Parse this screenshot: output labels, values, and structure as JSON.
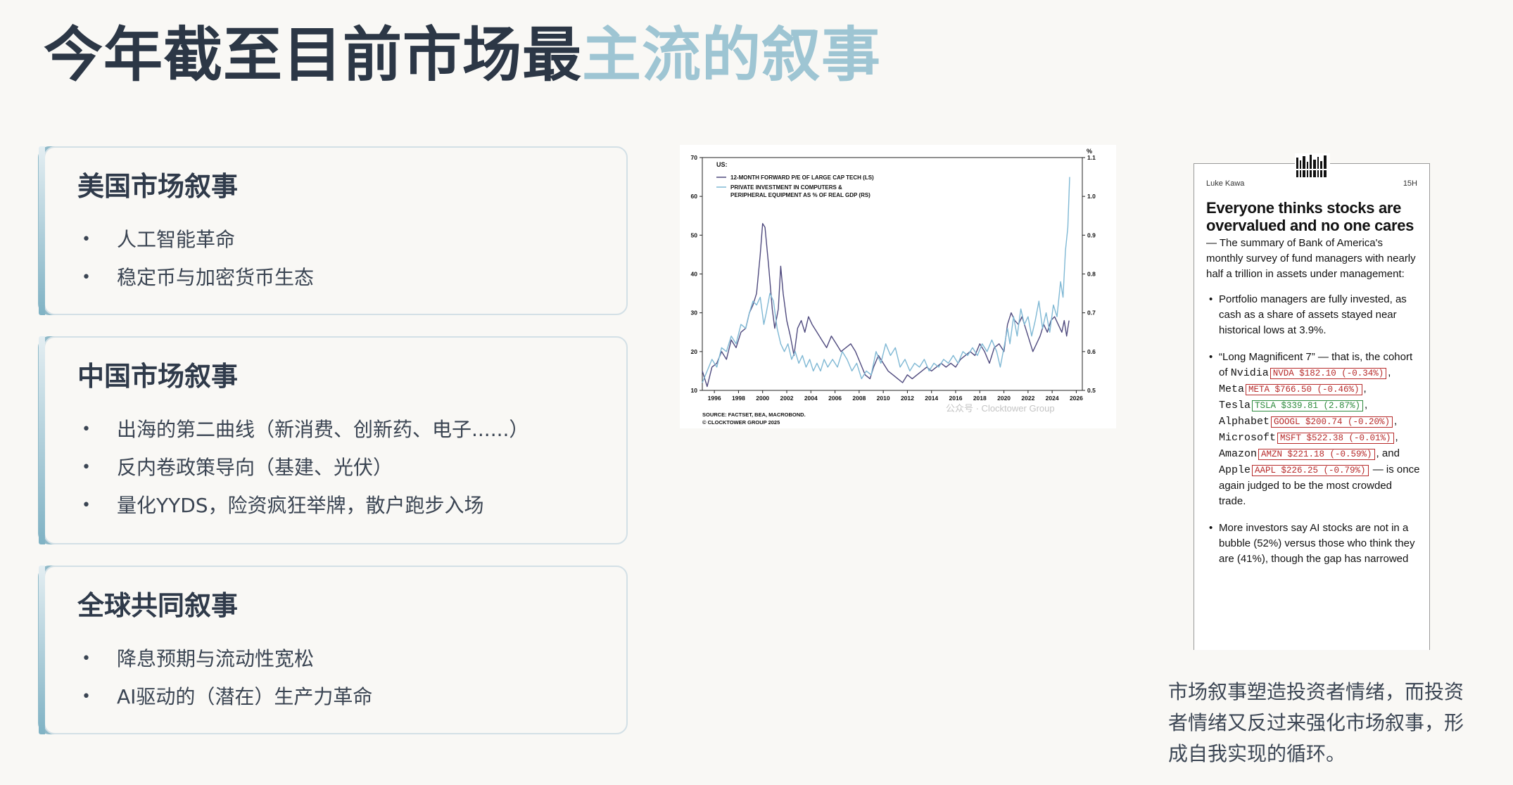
{
  "title": {
    "dark": "今年截至目前市场最",
    "light": "主流的叙事"
  },
  "cards": [
    {
      "title": "美国市场叙事",
      "items": [
        "人工智能革命",
        "稳定币与加密货币生态"
      ]
    },
    {
      "title": "中国市场叙事",
      "items": [
        "出海的第二曲线（新消费、创新药、电子......）",
        "反内卷政策导向（基建、光伏）",
        "量化YYDS，险资疯狂举牌，散户跑步入场"
      ]
    },
    {
      "title": "全球共同叙事",
      "items": [
        "降息预期与流动性宽松",
        "AI驱动的（潜在）生产力革命"
      ]
    }
  ],
  "chart_data": {
    "type": "line",
    "title": "US:",
    "unit_right": "%",
    "xlim": [
      1995,
      2026.5
    ],
    "x_ticks": [
      "1996",
      "1998",
      "2000",
      "2002",
      "2004",
      "2006",
      "2008",
      "2010",
      "2012",
      "2014",
      "2016",
      "2018",
      "2020",
      "2022",
      "2024",
      "2026"
    ],
    "ylim_left": [
      10,
      70
    ],
    "y_ticks_left": [
      "10",
      "20",
      "30",
      "40",
      "50",
      "60",
      "70"
    ],
    "ylim_right": [
      0.5,
      1.1
    ],
    "y_ticks_right": [
      "0.5",
      "0.6",
      "0.7",
      "0.8",
      "0.9",
      "1.0",
      "1.1"
    ],
    "series": [
      {
        "name": "12-MONTH FORWARD P/E OF LARGE CAP TECH (LS)",
        "axis": "left",
        "color": "#4f4a7e",
        "points": [
          [
            1995.0,
            15
          ],
          [
            1995.4,
            11
          ],
          [
            1995.8,
            16
          ],
          [
            1996.2,
            17
          ],
          [
            1996.6,
            20
          ],
          [
            1997.0,
            18
          ],
          [
            1997.4,
            23
          ],
          [
            1997.8,
            21
          ],
          [
            1998.2,
            25
          ],
          [
            1998.6,
            26
          ],
          [
            1998.9,
            30
          ],
          [
            1999.2,
            32
          ],
          [
            1999.5,
            35
          ],
          [
            1999.8,
            45
          ],
          [
            2000.0,
            53
          ],
          [
            2000.2,
            52
          ],
          [
            2000.5,
            42
          ],
          [
            2000.8,
            31
          ],
          [
            2001.0,
            26
          ],
          [
            2001.3,
            31
          ],
          [
            2001.5,
            42
          ],
          [
            2001.7,
            35
          ],
          [
            2002.0,
            28
          ],
          [
            2002.3,
            24
          ],
          [
            2002.6,
            19
          ],
          [
            2002.9,
            26
          ],
          [
            2003.2,
            28
          ],
          [
            2003.5,
            25
          ],
          [
            2003.8,
            29
          ],
          [
            2004.1,
            27
          ],
          [
            2004.5,
            25
          ],
          [
            2004.9,
            23
          ],
          [
            2005.3,
            21
          ],
          [
            2005.7,
            24
          ],
          [
            2006.1,
            22
          ],
          [
            2006.5,
            20
          ],
          [
            2006.9,
            21
          ],
          [
            2007.3,
            22
          ],
          [
            2007.7,
            20
          ],
          [
            2008.1,
            17
          ],
          [
            2008.5,
            14
          ],
          [
            2008.9,
            13
          ],
          [
            2009.2,
            16
          ],
          [
            2009.6,
            19
          ],
          [
            2010.0,
            17
          ],
          [
            2010.4,
            15
          ],
          [
            2010.8,
            14
          ],
          [
            2011.2,
            13
          ],
          [
            2011.6,
            12
          ],
          [
            2012.0,
            14
          ],
          [
            2012.4,
            13
          ],
          [
            2012.8,
            14
          ],
          [
            2013.2,
            15
          ],
          [
            2013.6,
            16
          ],
          [
            2014.0,
            15
          ],
          [
            2014.4,
            16
          ],
          [
            2014.8,
            17
          ],
          [
            2015.2,
            16
          ],
          [
            2015.6,
            17
          ],
          [
            2016.0,
            16
          ],
          [
            2016.4,
            18
          ],
          [
            2016.8,
            19
          ],
          [
            2017.2,
            20
          ],
          [
            2017.6,
            19
          ],
          [
            2018.0,
            22
          ],
          [
            2018.4,
            20
          ],
          [
            2018.8,
            17
          ],
          [
            2019.2,
            21
          ],
          [
            2019.6,
            22
          ],
          [
            2020.0,
            20
          ],
          [
            2020.3,
            27
          ],
          [
            2020.6,
            30
          ],
          [
            2020.9,
            28
          ],
          [
            2021.2,
            27
          ],
          [
            2021.5,
            29
          ],
          [
            2021.8,
            26
          ],
          [
            2022.1,
            23
          ],
          [
            2022.4,
            20
          ],
          [
            2022.7,
            22
          ],
          [
            2023.0,
            24
          ],
          [
            2023.3,
            27
          ],
          [
            2023.6,
            25
          ],
          [
            2023.9,
            28
          ],
          [
            2024.2,
            29
          ],
          [
            2024.5,
            27
          ],
          [
            2024.8,
            25
          ],
          [
            2025.0,
            28
          ],
          [
            2025.2,
            24
          ],
          [
            2025.4,
            28
          ]
        ]
      },
      {
        "name": "PRIVATE INVESTMENT IN COMPUTERS & PERIPHERAL EQUIPMENT AS % OF REAL GDP (RS)",
        "axis": "right",
        "color": "#7fb8d4",
        "points": [
          [
            1995.0,
            0.52
          ],
          [
            1995.4,
            0.55
          ],
          [
            1995.8,
            0.58
          ],
          [
            1996.2,
            0.56
          ],
          [
            1996.6,
            0.61
          ],
          [
            1997.0,
            0.6
          ],
          [
            1997.4,
            0.64
          ],
          [
            1997.8,
            0.62
          ],
          [
            1998.2,
            0.67
          ],
          [
            1998.6,
            0.66
          ],
          [
            1998.9,
            0.7
          ],
          [
            1999.2,
            0.73
          ],
          [
            1999.5,
            0.72
          ],
          [
            1999.8,
            0.74
          ],
          [
            2000.1,
            0.67
          ],
          [
            2000.3,
            0.7
          ],
          [
            2000.6,
            0.75
          ],
          [
            2000.9,
            0.73
          ],
          [
            2001.2,
            0.66
          ],
          [
            2001.5,
            0.62
          ],
          [
            2001.8,
            0.6
          ],
          [
            2002.1,
            0.62
          ],
          [
            2002.4,
            0.58
          ],
          [
            2002.7,
            0.6
          ],
          [
            2003.0,
            0.57
          ],
          [
            2003.3,
            0.59
          ],
          [
            2003.6,
            0.56
          ],
          [
            2003.9,
            0.58
          ],
          [
            2004.2,
            0.55
          ],
          [
            2004.5,
            0.57
          ],
          [
            2004.8,
            0.55
          ],
          [
            2005.1,
            0.58
          ],
          [
            2005.4,
            0.56
          ],
          [
            2005.8,
            0.58
          ],
          [
            2006.2,
            0.56
          ],
          [
            2006.6,
            0.6
          ],
          [
            2007.0,
            0.58
          ],
          [
            2007.4,
            0.55
          ],
          [
            2007.8,
            0.57
          ],
          [
            2008.2,
            0.53
          ],
          [
            2008.6,
            0.55
          ],
          [
            2009.0,
            0.54
          ],
          [
            2009.4,
            0.6
          ],
          [
            2009.8,
            0.57
          ],
          [
            2010.2,
            0.62
          ],
          [
            2010.6,
            0.59
          ],
          [
            2011.0,
            0.61
          ],
          [
            2011.4,
            0.56
          ],
          [
            2011.8,
            0.58
          ],
          [
            2012.2,
            0.55
          ],
          [
            2012.6,
            0.57
          ],
          [
            2013.0,
            0.56
          ],
          [
            2013.4,
            0.58
          ],
          [
            2013.8,
            0.55
          ],
          [
            2014.2,
            0.57
          ],
          [
            2014.6,
            0.56
          ],
          [
            2015.0,
            0.58
          ],
          [
            2015.4,
            0.57
          ],
          [
            2015.8,
            0.59
          ],
          [
            2016.2,
            0.57
          ],
          [
            2016.6,
            0.6
          ],
          [
            2017.0,
            0.59
          ],
          [
            2017.4,
            0.61
          ],
          [
            2017.8,
            0.59
          ],
          [
            2018.2,
            0.62
          ],
          [
            2018.6,
            0.6
          ],
          [
            2019.0,
            0.63
          ],
          [
            2019.4,
            0.6
          ],
          [
            2019.7,
            0.56
          ],
          [
            2020.0,
            0.61
          ],
          [
            2020.3,
            0.66
          ],
          [
            2020.5,
            0.62
          ],
          [
            2020.8,
            0.69
          ],
          [
            2021.1,
            0.64
          ],
          [
            2021.4,
            0.71
          ],
          [
            2021.7,
            0.67
          ],
          [
            2022.0,
            0.69
          ],
          [
            2022.3,
            0.64
          ],
          [
            2022.6,
            0.68
          ],
          [
            2022.9,
            0.73
          ],
          [
            2023.2,
            0.66
          ],
          [
            2023.5,
            0.7
          ],
          [
            2023.8,
            0.65
          ],
          [
            2024.1,
            0.72
          ],
          [
            2024.4,
            0.69
          ],
          [
            2024.7,
            0.78
          ],
          [
            2024.9,
            0.74
          ],
          [
            2025.1,
            0.86
          ],
          [
            2025.3,
            0.92
          ],
          [
            2025.45,
            1.05
          ]
        ]
      }
    ],
    "source": "SOURCE: FACTSET, BEA, MACROBOND.",
    "copyright": "© CLOCKTOWER GROUP 2025",
    "watermark": "公众号 · Clocktower Group"
  },
  "tweet": {
    "author": "Luke Kawa",
    "time": "15H",
    "headline": "Everyone thinks stocks are overvalued and no one cares",
    "summary": " — The summary of Bank of America's monthly survey of fund managers with nearly half a trillion in assets under management:",
    "bullet1": "Portfolio managers are fully invested, as cash as a share of assets stayed near historical lows at 3.9%.",
    "bullet2_intro": "“Long Magnificent 7” — that is, the cohort of ",
    "stocks": [
      {
        "name": "Nvidia",
        "ticker": "NVDA $182.10 (-0.34%)",
        "dir": "neg",
        "sep": ", "
      },
      {
        "name": "Meta",
        "ticker": "META $766.50 (-0.46%)",
        "dir": "neg",
        "sep": ", "
      },
      {
        "name": "Tesla",
        "ticker": "TSLA $339.81 (2.87%)",
        "dir": "pos",
        "sep": ", "
      },
      {
        "name": "Alphabet",
        "ticker": "GOOGL $200.74 (-0.20%)",
        "dir": "neg",
        "sep": ", "
      },
      {
        "name": "Microsoft",
        "ticker": "MSFT $522.38 (-0.01%)",
        "dir": "neg",
        "sep": ", "
      },
      {
        "name": "Amazon",
        "ticker": "AMZN $221.18 (-0.59%)",
        "dir": "neg",
        "sep": ", and "
      },
      {
        "name": "Apple",
        "ticker": "AAPL $226.25 (-0.79%)",
        "dir": "neg",
        "sep": ""
      }
    ],
    "bullet2_outro": " — is once again judged to be the most crowded trade.",
    "bullet3": "More investors say AI stocks are not in a bubble (52%) versus those who think they are (41%), though the gap has narrowed"
  },
  "caption": "市场叙事塑造投资者情绪，而投资者情绪又反过来强化市场叙事，形成自我实现的循环。"
}
